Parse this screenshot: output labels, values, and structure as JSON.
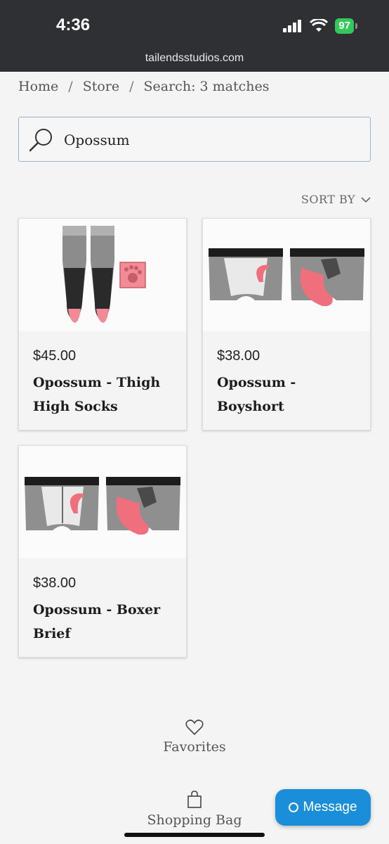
{
  "status_bar": {
    "time": "4:36",
    "battery": "97"
  },
  "browser": {
    "url": "tailendsstudios.com"
  },
  "breadcrumb": {
    "home": "Home",
    "sep": "/",
    "store": "Store",
    "current": "Search: 3 matches"
  },
  "search": {
    "value": "Opossum",
    "icon": "search-icon"
  },
  "sort": {
    "label": "SORT BY"
  },
  "products": [
    {
      "price": "$45.00",
      "name": "Opossum - Thigh High Socks"
    },
    {
      "price": "$38.00",
      "name": "Opossum - Boyshort"
    },
    {
      "price": "$38.00",
      "name": "Opossum - Boxer Brief"
    }
  ],
  "footer": {
    "favorites": "Favorites",
    "bag": "Shopping Bag"
  },
  "message_button": {
    "label": "Message"
  },
  "colors": {
    "accent": "#1a8ed9",
    "topbar": "#2e3034",
    "battery": "#34c759",
    "pink": "#ef6f7d",
    "gray": "#8f8f8f"
  }
}
